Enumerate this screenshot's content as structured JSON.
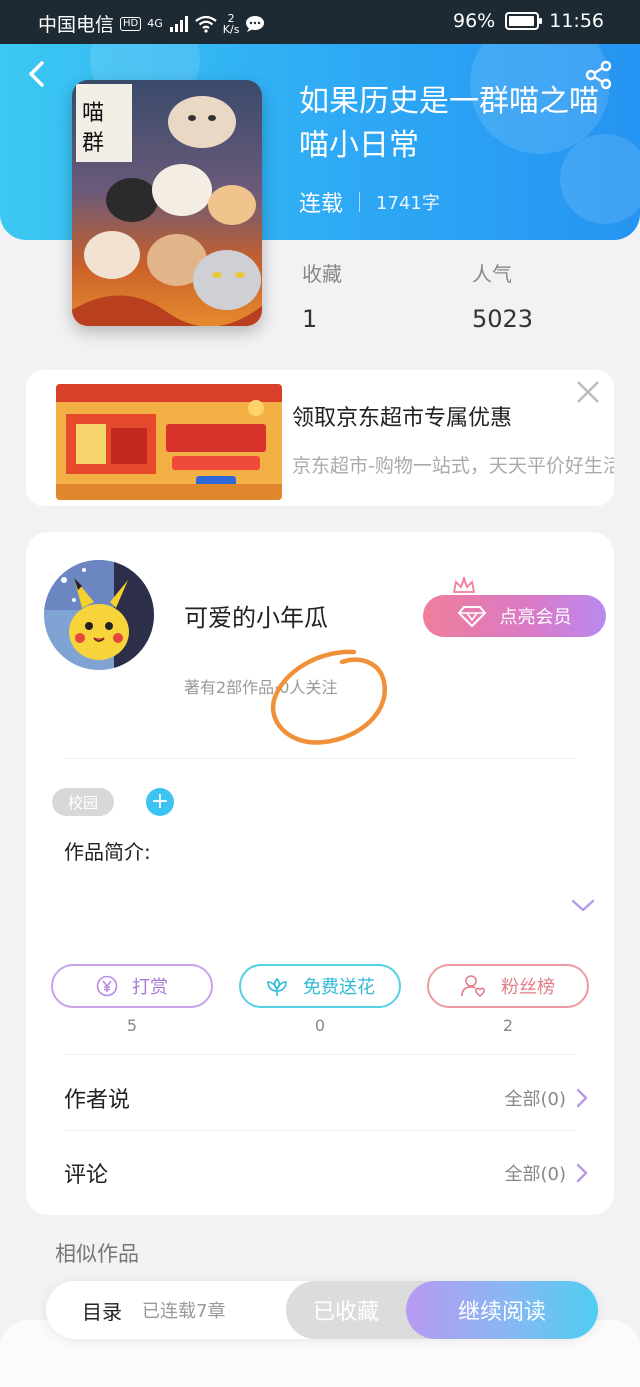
{
  "status_bar": {
    "carrier": "中国电信",
    "hd": "HD",
    "network": "4G",
    "speed_value": "2",
    "speed_unit": "K/s",
    "battery": "96%",
    "battery_level": 0.96,
    "time": "11:56"
  },
  "book": {
    "title": "如果历史是一群喵之喵喵小日常",
    "status": "连载",
    "word_count": "1741字",
    "stats": [
      {
        "label": "收藏",
        "value": "1"
      },
      {
        "label": "人气",
        "value": "5023"
      }
    ]
  },
  "ad": {
    "title": "领取京东超市专属优惠",
    "description": "京东超市-购物一站式，天天平价好生活"
  },
  "author": {
    "name": "可爱的小年瓜",
    "summary": "著有2部作品·0人关注",
    "vip_button": "点亮会员",
    "tag": "校园",
    "tag_add": "+",
    "intro_label": "作品简介:"
  },
  "actions": [
    {
      "label": "打赏",
      "count": "5",
      "icon": "yen-icon"
    },
    {
      "label": "免费送花",
      "count": "0",
      "icon": "flower-icon"
    },
    {
      "label": "粉丝榜",
      "count": "2",
      "icon": "fans-icon"
    }
  ],
  "rows": [
    {
      "title": "作者说",
      "value": "全部(0)"
    },
    {
      "title": "评论",
      "value": "全部(0)"
    }
  ],
  "similar_label": "相似作品",
  "bottom_bar": {
    "toc": "目录",
    "chapters": "已连载7章",
    "collected": "已收藏",
    "read": "继续阅读"
  },
  "colors": {
    "hero_start": "#3cc8f2",
    "hero_end": "#2594f2",
    "annotation": "#f0913a"
  }
}
